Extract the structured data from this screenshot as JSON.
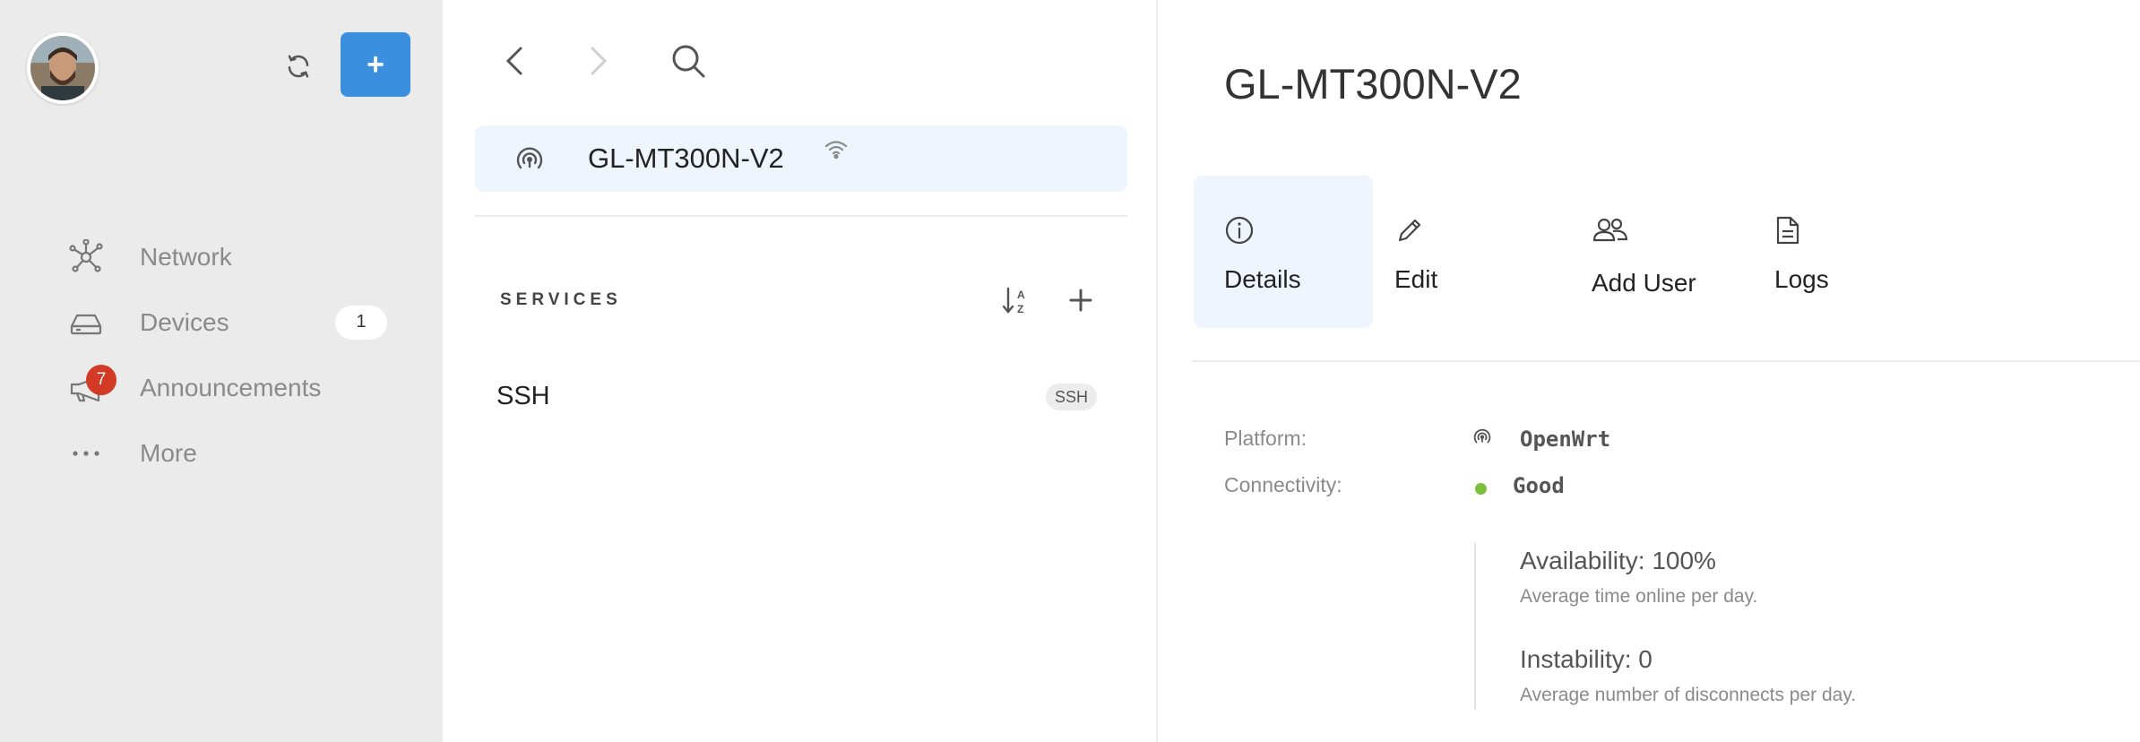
{
  "sidebar": {
    "add_button_label": "+",
    "nav": [
      {
        "label": "Network",
        "icon": "network-icon"
      },
      {
        "label": "Devices",
        "icon": "router-icon",
        "count": "1"
      },
      {
        "label": "Announcements",
        "icon": "megaphone-icon",
        "badge": "7"
      },
      {
        "label": "More",
        "icon": "more-icon"
      }
    ]
  },
  "devices": {
    "selected": {
      "name": "GL-MT300N-V2"
    }
  },
  "services": {
    "heading": "SERVICES",
    "items": [
      {
        "name": "SSH",
        "tag": "SSH"
      }
    ]
  },
  "detail": {
    "title": "GL-MT300N-V2",
    "tabs": [
      {
        "label": "Details",
        "icon": "info-icon",
        "active": true
      },
      {
        "label": "Edit",
        "icon": "pencil-icon"
      },
      {
        "label": "Add User",
        "icon": "users-icon"
      },
      {
        "label": "Logs",
        "icon": "document-icon"
      }
    ],
    "properties": {
      "platform_label": "Platform:",
      "platform_value": "OpenWrt",
      "connectivity_label": "Connectivity:",
      "connectivity_value": "Good"
    },
    "stats": {
      "availability_title": "Availability: 100%",
      "availability_desc": "Average time online per day.",
      "instability_title": "Instability: 0",
      "instability_desc": "Average number of disconnects per day."
    }
  },
  "colors": {
    "accent": "#3b8fde",
    "selected_bg": "#eef5fc",
    "sidebar_bg": "#ebebeb",
    "badge_red": "#d23a25",
    "status_good": "#7bbf3a"
  }
}
